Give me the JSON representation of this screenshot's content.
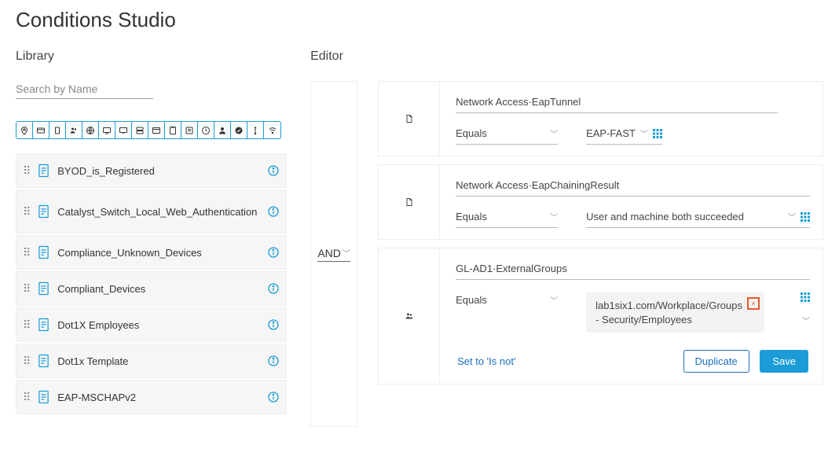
{
  "title": "Conditions Studio",
  "library": {
    "heading": "Library",
    "search_placeholder": "Search by Name",
    "filter_icons": [
      "location-pin-icon",
      "id-card-icon",
      "device-icon",
      "group-icon",
      "globe-icon",
      "monitor-icon",
      "network-monitor-icon",
      "server-icon",
      "browser-icon",
      "tablet-icon",
      "list-icon",
      "clock-icon",
      "user-icon",
      "check-circle-icon",
      "usb-icon",
      "wifi-icon"
    ],
    "items": [
      {
        "label": "BYOD_is_Registered"
      },
      {
        "label": "Catalyst_Switch_Local_Web_Authentication",
        "tall": true
      },
      {
        "label": "Compliance_Unknown_Devices"
      },
      {
        "label": "Compliant_Devices"
      },
      {
        "label": "Dot1X Employees"
      },
      {
        "label": "Dot1x Template"
      },
      {
        "label": "EAP-MSCHAPv2"
      }
    ]
  },
  "editor": {
    "heading": "Editor",
    "combiner": "AND",
    "rules": [
      {
        "icon": "page-icon",
        "attribute": "Network Access·EapTunnel",
        "operator": "Equals",
        "value": "EAP-FAST"
      },
      {
        "icon": "page-icon",
        "attribute": "Network Access·EapChainingResult",
        "operator": "Equals",
        "value": "User and machine both succeeded"
      },
      {
        "icon": "group-icon",
        "attribute": "GL-AD1·ExternalGroups",
        "operator": "Equals",
        "value": "lab1six1.com/Workplace/Groups - Security/Employees"
      }
    ],
    "set_isnot": "Set to 'Is not'",
    "duplicate": "Duplicate",
    "save": "Save"
  }
}
